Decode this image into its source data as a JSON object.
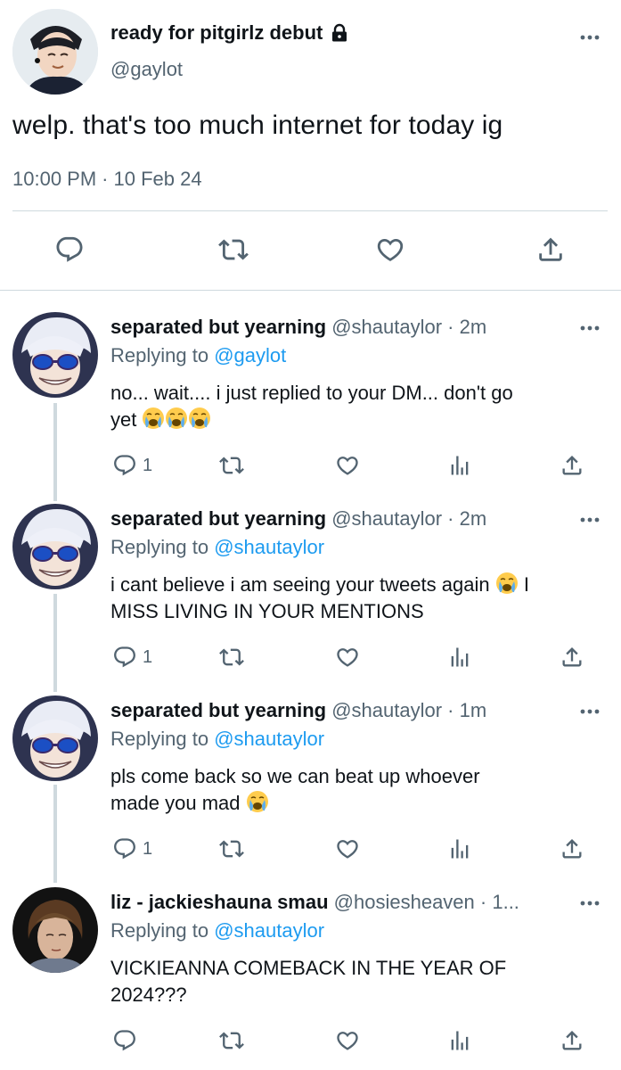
{
  "main_tweet": {
    "author_name": "ready for pitgirlz debut",
    "author_handle": "@gaylot",
    "text": "welp. that's too much internet for today ig",
    "time": "10:00 PM",
    "separator": "·",
    "date": "10 Feb 24"
  },
  "replies": [
    {
      "name": "separated but yearning",
      "handle": "@shautaylor",
      "time": "· 2m",
      "replying_prefix": "Replying to",
      "replying_to": "@gaylot",
      "text_line1": "no... wait.... i just replied to your DM... don't go",
      "text_line2": "yet",
      "reply_count": "1"
    },
    {
      "name": "separated but yearning",
      "handle": "@shautaylor",
      "time": "· 2m",
      "replying_prefix": "Replying to",
      "replying_to": "@shautaylor",
      "text_line1a": "i cant believe i am seeing your tweets again",
      "text_line1b": "I",
      "text_line2": "MISS LIVING IN YOUR MENTIONS",
      "reply_count": "1"
    },
    {
      "name": "separated but yearning",
      "handle": "@shautaylor",
      "time": "· 1m",
      "replying_prefix": "Replying to",
      "replying_to": "@shautaylor",
      "text_line1": "pls come back so we can beat up whoever",
      "text_line2": "made you mad",
      "reply_count": "1"
    },
    {
      "name": "liz - jackieshauna smau",
      "handle": "@hosiesheaven",
      "time": "· 1...",
      "replying_prefix": "Replying to",
      "replying_to": "@shautaylor",
      "text_line1": "VICKIEANNA COMEBACK IN THE YEAR OF",
      "text_line2": "2024???",
      "reply_count": ""
    }
  ],
  "colors": {
    "link": "#1d9bf0",
    "secondary_text": "#536471",
    "divider": "#cfd9de"
  }
}
